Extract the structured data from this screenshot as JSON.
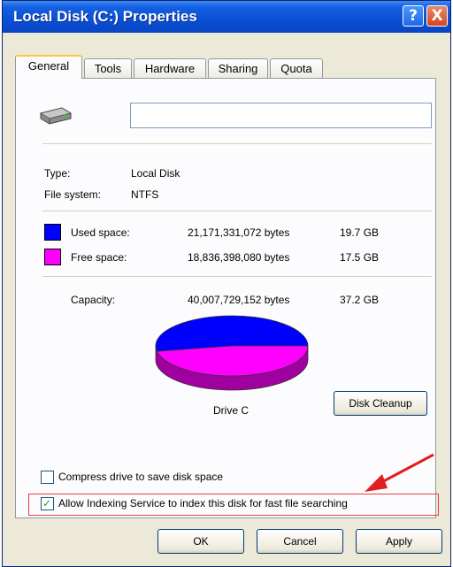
{
  "window": {
    "title": "Local Disk (C:) Properties"
  },
  "title_buttons": {
    "help": "?",
    "close": "X"
  },
  "tabs": [
    "General",
    "Tools",
    "Hardware",
    "Sharing",
    "Quota"
  ],
  "drive_name": {
    "value": ""
  },
  "info": {
    "type_label": "Type:",
    "type_value": "Local Disk",
    "fs_label": "File system:",
    "fs_value": "NTFS"
  },
  "space": {
    "used": {
      "label": "Used space:",
      "bytes": "21,171,331,072 bytes",
      "size": "19.7 GB",
      "color": "#0000ff"
    },
    "free": {
      "label": "Free space:",
      "bytes": "18,836,398,080 bytes",
      "size": "17.5 GB",
      "color": "#ff00ff"
    },
    "capacity": {
      "label": "Capacity:",
      "bytes": "40,007,729,152 bytes",
      "size": "37.2 GB"
    }
  },
  "chart_data": {
    "type": "pie",
    "categories": [
      "Used space",
      "Free space"
    ],
    "values": [
      21171331072,
      18836398080
    ],
    "colors": [
      "#0000ff",
      "#ff00ff"
    ],
    "label": "Drive C"
  },
  "buttons": {
    "disk_cleanup": "Disk Cleanup",
    "ok": "OK",
    "cancel": "Cancel",
    "apply": "Apply"
  },
  "options": {
    "compress": {
      "label": "Compress drive to save disk space",
      "checked": false
    },
    "indexing": {
      "label": "Allow Indexing Service to index this disk for fast file searching",
      "checked": true
    }
  },
  "annotation": {
    "color": "#e02020"
  }
}
